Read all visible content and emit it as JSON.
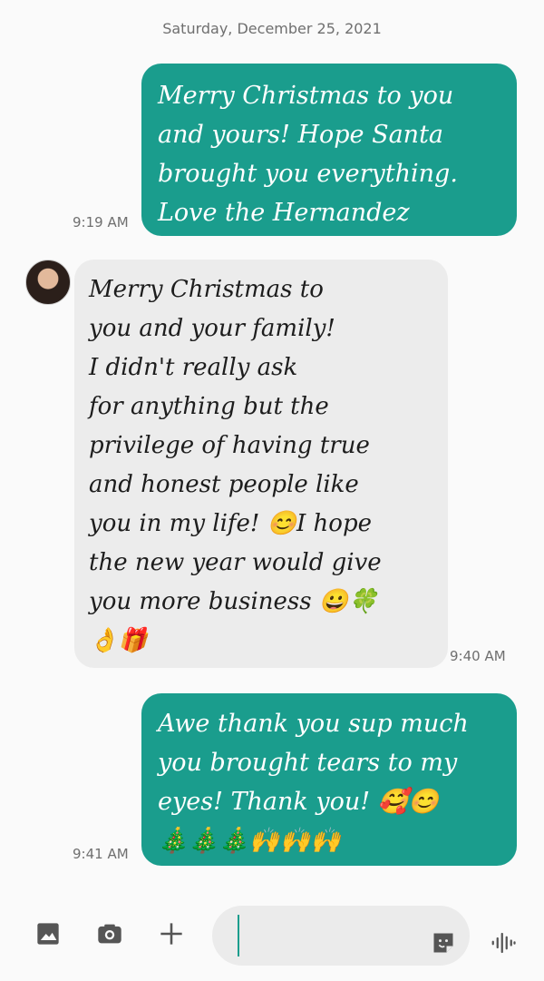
{
  "date_header": "Saturday, December 25, 2021",
  "messages": [
    {
      "direction": "outgoing",
      "text": "Merry Christmas to you\nand yours! Hope Santa\nbrought you everything.\nLove the Hernandez",
      "time": "9:19 AM"
    },
    {
      "direction": "incoming",
      "text": "Merry Christmas to\nyou and your family!\nI didn't really ask\nfor anything but the\nprivilege of having true\nand honest people like\nyou in my life! 😊I hope\nthe new year would give\nyou more business 😀🍀\n👌🎁",
      "time": "9:40 AM"
    },
    {
      "direction": "outgoing",
      "text": "Awe thank you sup much\nyou brought tears to my\neyes! Thank you! 🥰😊\n🎄🎄🎄🙌🙌🙌",
      "time": "9:41 AM"
    }
  ],
  "composer": {
    "icons": [
      "gallery-icon",
      "camera-icon",
      "plus-icon",
      "sticker-icon",
      "voice-icon"
    ],
    "input_value": ""
  },
  "colors": {
    "outgoing_bubble": "#1a9d8d",
    "incoming_bubble": "#ececec",
    "background": "#fafafa"
  }
}
